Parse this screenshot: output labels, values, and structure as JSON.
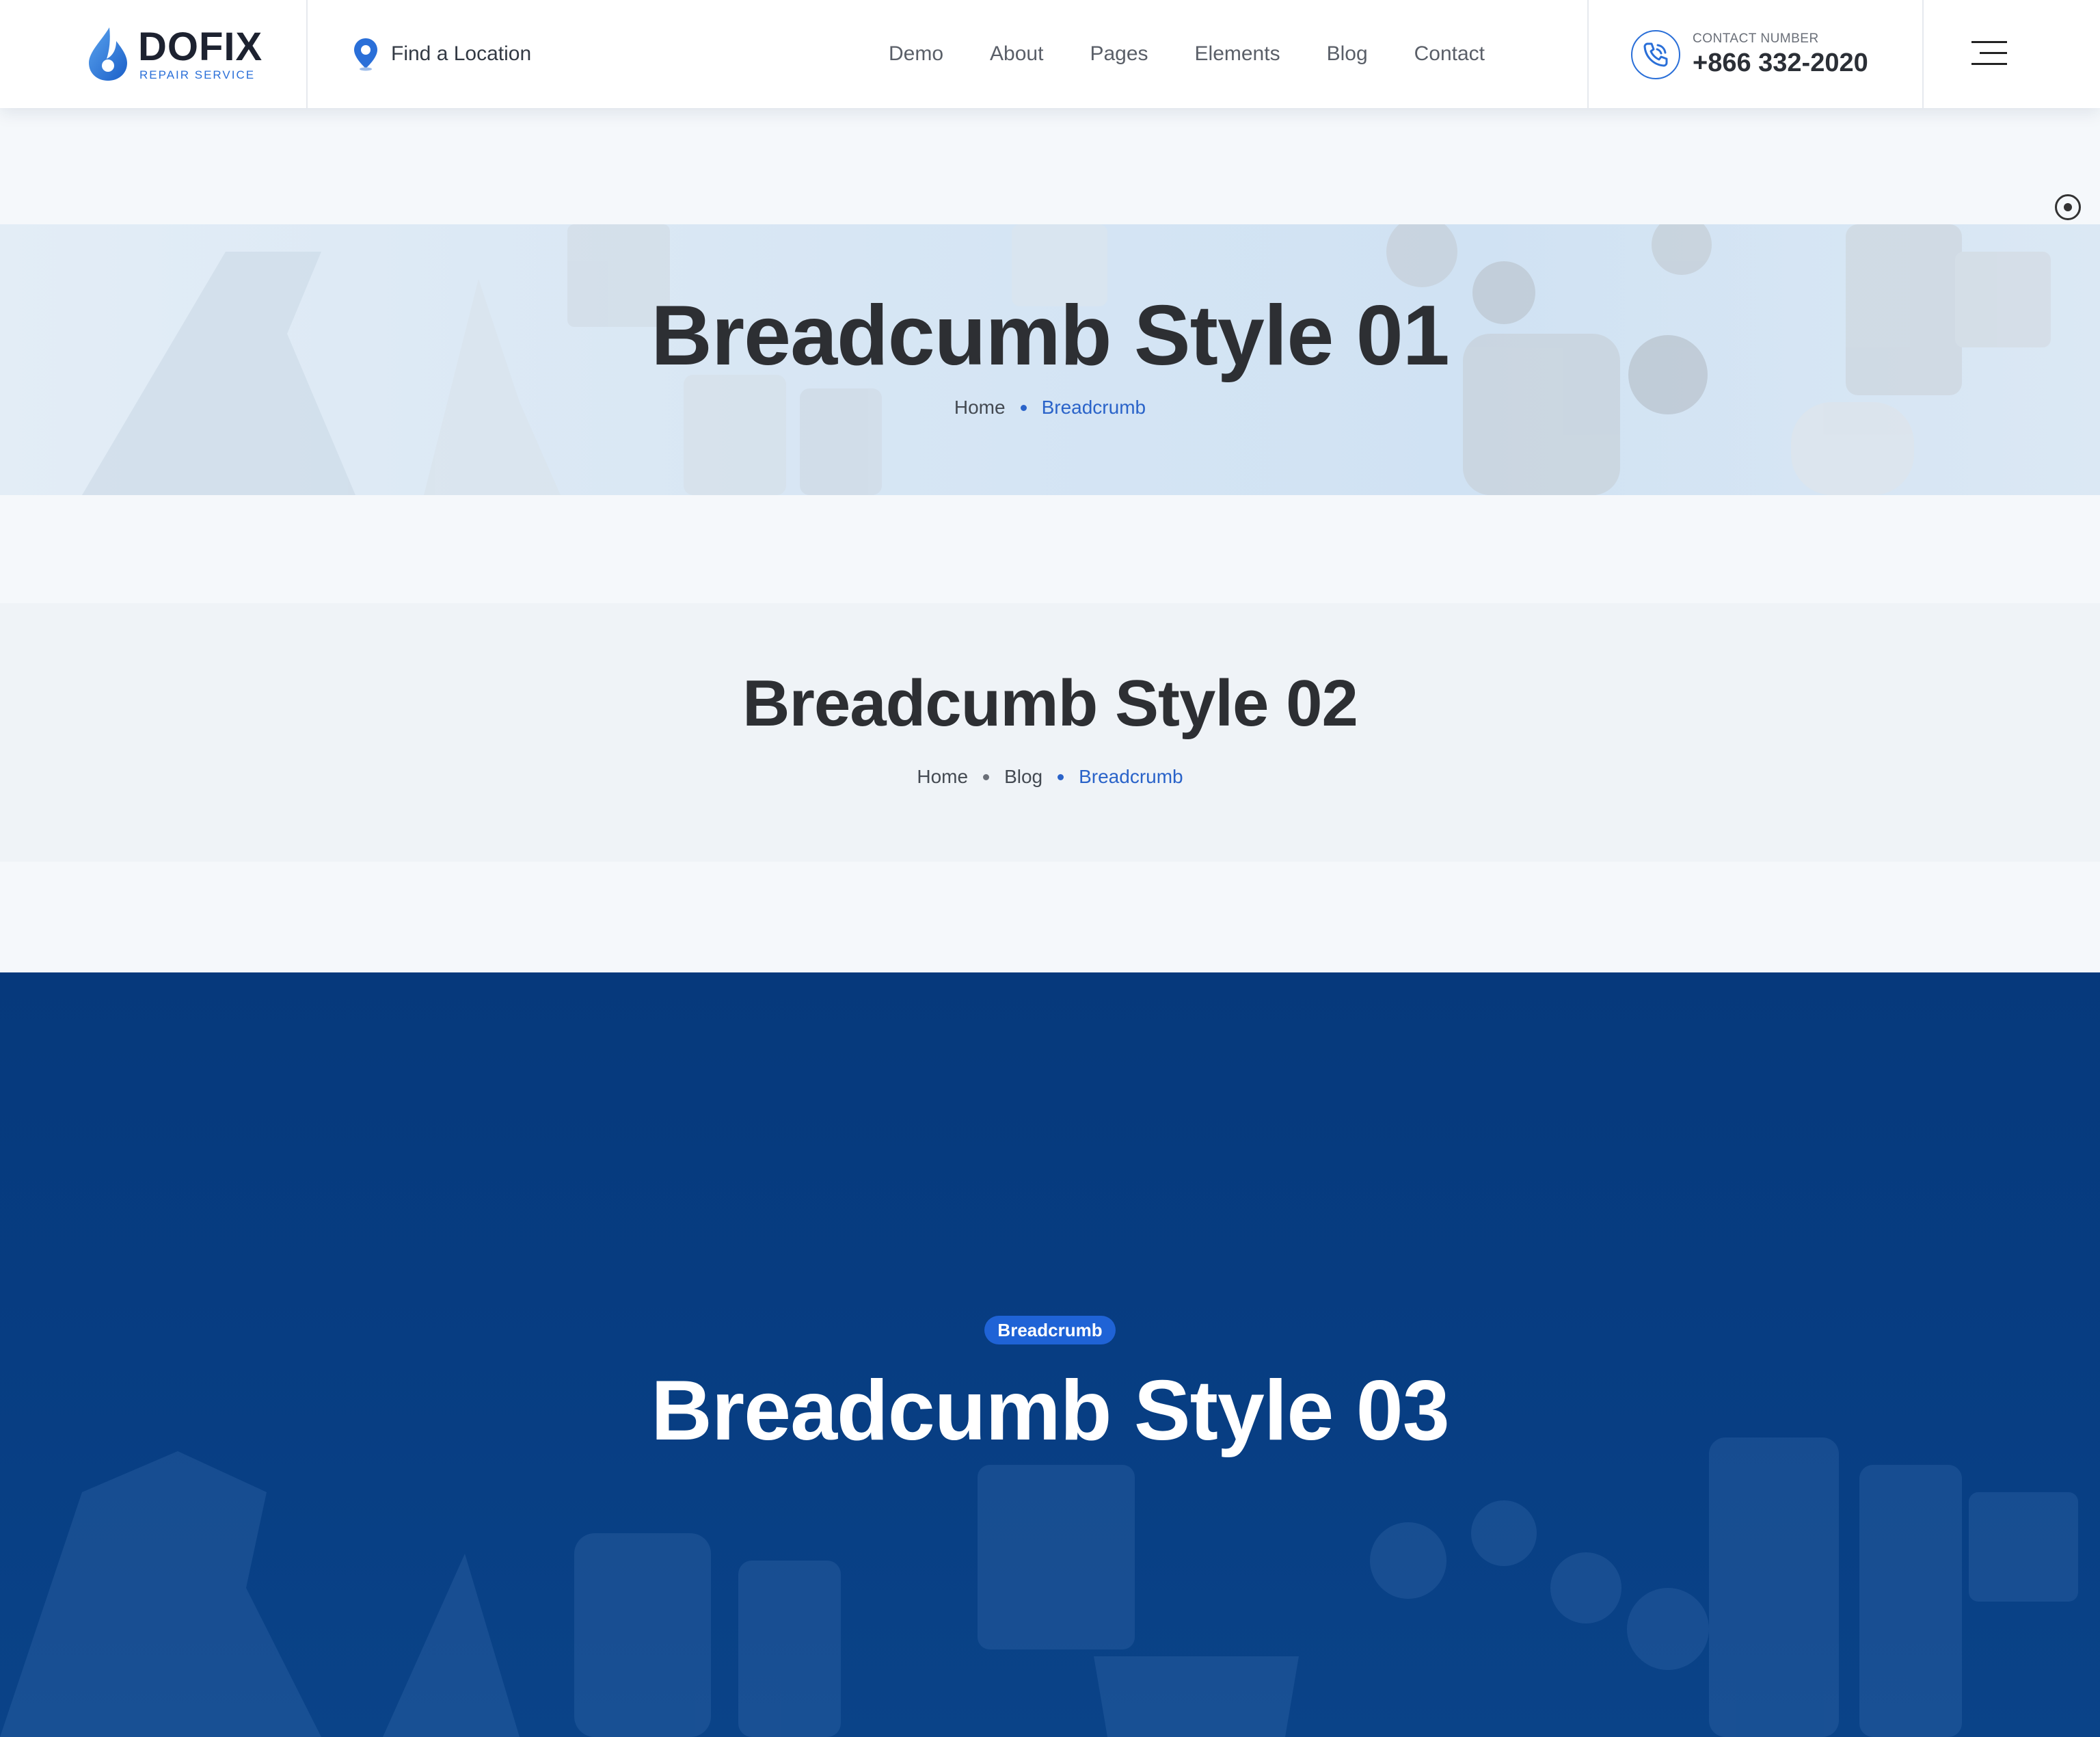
{
  "header": {
    "logo": {
      "name": "DOFIX",
      "tagline": "REPAIR SERVICE"
    },
    "find_location": "Find a Location",
    "nav": [
      "Demo",
      "About",
      "Pages",
      "Elements",
      "Blog",
      "Contact"
    ],
    "contact": {
      "label": "CONTACT NUMBER",
      "number": "+866 332-2020"
    }
  },
  "breadcrumb_style_01": {
    "title": "Breadcumb Style 01",
    "crumbs": [
      "Home",
      "Breadcrumb"
    ]
  },
  "breadcrumb_style_02": {
    "title": "Breadcumb Style 02",
    "crumbs": [
      "Home",
      "Blog",
      "Breadcrumb"
    ]
  },
  "breadcrumb_style_03": {
    "badge": "Breadcrumb",
    "title": "Breadcumb Style 03"
  },
  "colors": {
    "accent": "#2a63c9",
    "brand_blue": "#1f63d6",
    "hero_dark_blue": "#06397c",
    "text_dark": "#2d2f33"
  },
  "icons": {
    "logo": "water-drop-icon",
    "find_location": "map-pin-icon",
    "contact": "phone-ring-icon",
    "menu": "hamburger-menu-icon",
    "scroll": "scroll-indicator-icon"
  }
}
